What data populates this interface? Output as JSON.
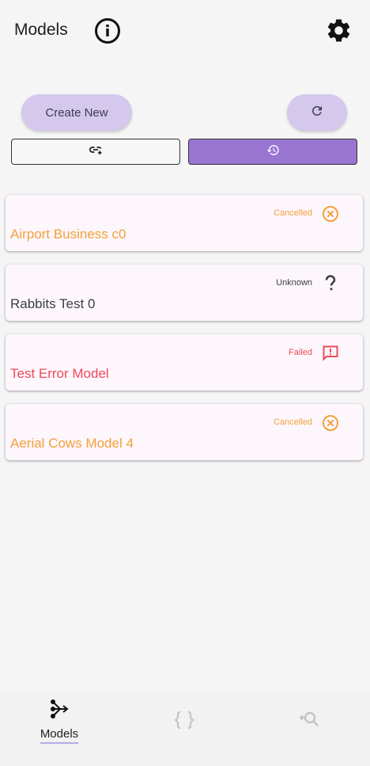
{
  "header": {
    "title": "Models",
    "info_icon": "info-circle-icon",
    "settings_icon": "gear-icon"
  },
  "actions": {
    "create_label": "Create New",
    "refresh_icon": "refresh-icon"
  },
  "view_toggle": {
    "selected": "history",
    "options": [
      {
        "id": "link",
        "icon": "add-link-icon"
      },
      {
        "id": "history",
        "icon": "history-icon"
      }
    ]
  },
  "models": [
    {
      "name": "Airport Business c0",
      "status": "Cancelled",
      "status_icon": "cancel-circle-icon",
      "color": "#f3a13a"
    },
    {
      "name": "Rabbits Test 0",
      "status": "Unknown",
      "status_icon": "question-mark-icon",
      "color": "#3c4047"
    },
    {
      "name": "Test Error Model",
      "status": "Failed",
      "status_icon": "feedback-alert-icon",
      "color": "#ee4a57"
    },
    {
      "name": "Aerial Cows Model 4",
      "status": "Cancelled",
      "status_icon": "cancel-circle-icon",
      "color": "#f3a13a"
    }
  ],
  "bottom_nav": {
    "items": [
      {
        "label": "Models",
        "icon": "model-branch-icon",
        "active": true
      },
      {
        "label": "",
        "icon": "curly-braces-icon",
        "active": false
      },
      {
        "label": "",
        "icon": "search-history-icon",
        "active": false
      }
    ]
  },
  "colors": {
    "accent": "#9a75d2",
    "button_bg": "#d4c8ec",
    "card_bg": "#fdf6fc"
  }
}
